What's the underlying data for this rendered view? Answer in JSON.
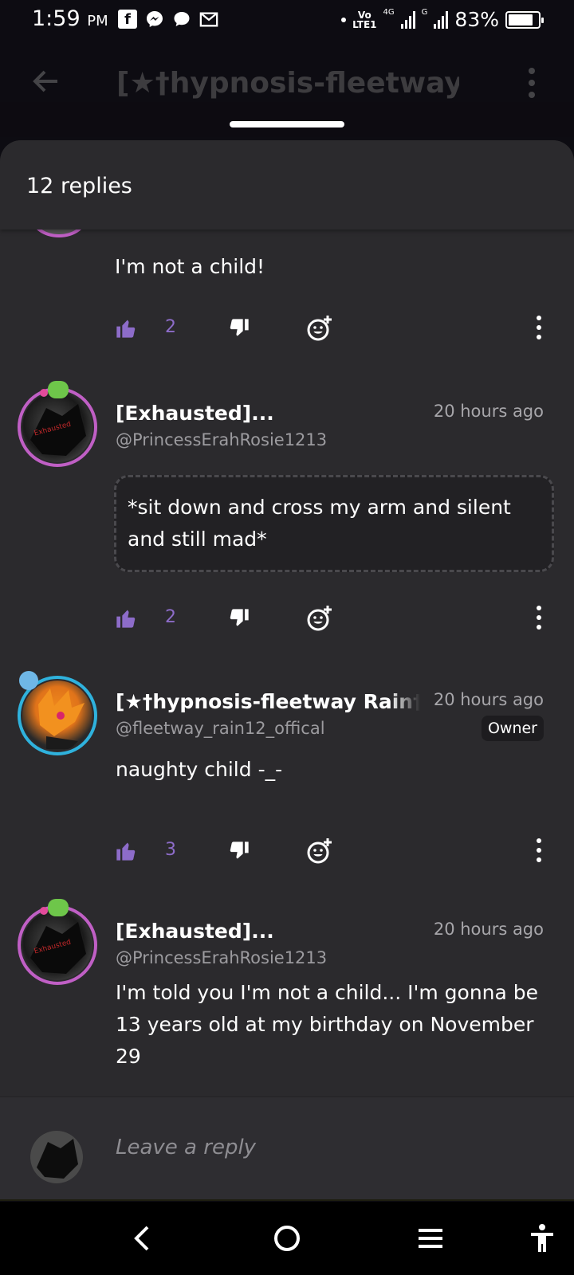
{
  "status_bar": {
    "time": "1:59",
    "time_suffix": "PM",
    "network_label_top": "Vo",
    "network_label_bottom": "LTE1",
    "net_4g": "4G",
    "net_g": "G",
    "battery_percent": "83%",
    "battery_level": 0.83,
    "notification_icons": [
      "facebook-icon",
      "messenger-icon",
      "chat-bubble-icon",
      "gmail-icon"
    ]
  },
  "background_header": {
    "title": "[★†hypnosis-fleetway Ra"
  },
  "sheet": {
    "title": "12 replies"
  },
  "first_partial": {
    "text": "I'm not a child!",
    "likes": "2"
  },
  "comments": [
    {
      "name": "[Exhausted]...",
      "handle": "@PrincessErahRosie1213",
      "time": "20 hours ago",
      "text": "*sit down and cross my arm and silent and still mad*",
      "likes": "2",
      "avatar_text": "Exhausted"
    },
    {
      "name": "[★†hypnosis-fleetway Rain†★",
      "handle": "@fleetway_rain12_offical",
      "time": "20 hours ago",
      "role": "Owner",
      "text": "naughty child -_-",
      "likes": "3"
    },
    {
      "name": "[Exhausted]...",
      "handle": "@PrincessErahRosie1213",
      "time": "20 hours ago",
      "text": "I'm told you I'm not a child... I'm gonna be 13 years old at my birthday on November 29",
      "avatar_text": "Exhausted"
    }
  ],
  "reply_bar": {
    "placeholder": "Leave a reply"
  },
  "colors": {
    "accent_purple": "#8d6cc9",
    "sheet_bg": "#2b2a2d",
    "ring_pink": "#c05fc5",
    "ring_cyan": "#2fb2dd"
  }
}
